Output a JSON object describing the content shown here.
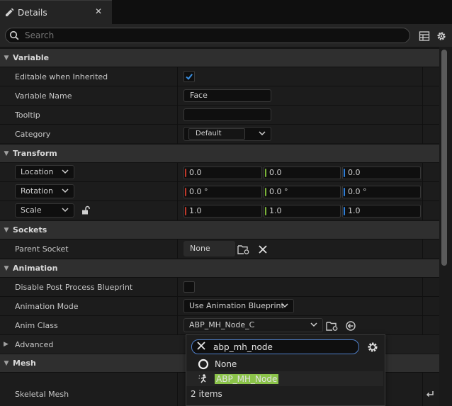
{
  "tab": {
    "title": "Details",
    "close": "✕",
    "icon": "pencil-icon"
  },
  "search": {
    "placeholder": "Search"
  },
  "sections": {
    "variable": "Variable",
    "transform": "Transform",
    "sockets": "Sockets",
    "animation": "Animation",
    "advanced": "Advanced",
    "mesh": "Mesh"
  },
  "variable": {
    "editable_label": "Editable when Inherited",
    "editable_checked": true,
    "name_label": "Variable Name",
    "name_value": "Face",
    "tooltip_label": "Tooltip",
    "tooltip_value": "",
    "category_label": "Category",
    "category_value": "Default"
  },
  "transform": {
    "location": {
      "label": "Location",
      "x": "0.0",
      "y": "0.0",
      "z": "0.0"
    },
    "rotation": {
      "label": "Rotation",
      "x": "0.0 °",
      "y": "0.0 °",
      "z": "0.0 °"
    },
    "scale": {
      "label": "Scale",
      "x": "1.0",
      "y": "1.0",
      "z": "1.0"
    }
  },
  "sockets": {
    "parent_label": "Parent Socket",
    "parent_value": "None"
  },
  "animation": {
    "disable_pp_label": "Disable Post Process Blueprint",
    "disable_pp_checked": false,
    "mode_label": "Animation Mode",
    "mode_value": "Use Animation Blueprint",
    "class_label": "Anim Class",
    "class_value": "ABP_MH_Node_C"
  },
  "mesh": {
    "skeletal_label": "Skeletal Mesh"
  },
  "popup": {
    "query": "abp_mh_node",
    "items": [
      {
        "label": "None",
        "icon": "none-circle-icon"
      },
      {
        "label": "ABP_MH_Node",
        "icon": "anim-blueprint-icon",
        "highlighted": true
      }
    ],
    "count": "2 items"
  },
  "colors": {
    "x_axis": "#c0392b",
    "y_axis": "#7bb33a",
    "z_axis": "#2f7fd8",
    "highlight": "#8bc34a",
    "checkbox_check": "#3a8fe0"
  }
}
